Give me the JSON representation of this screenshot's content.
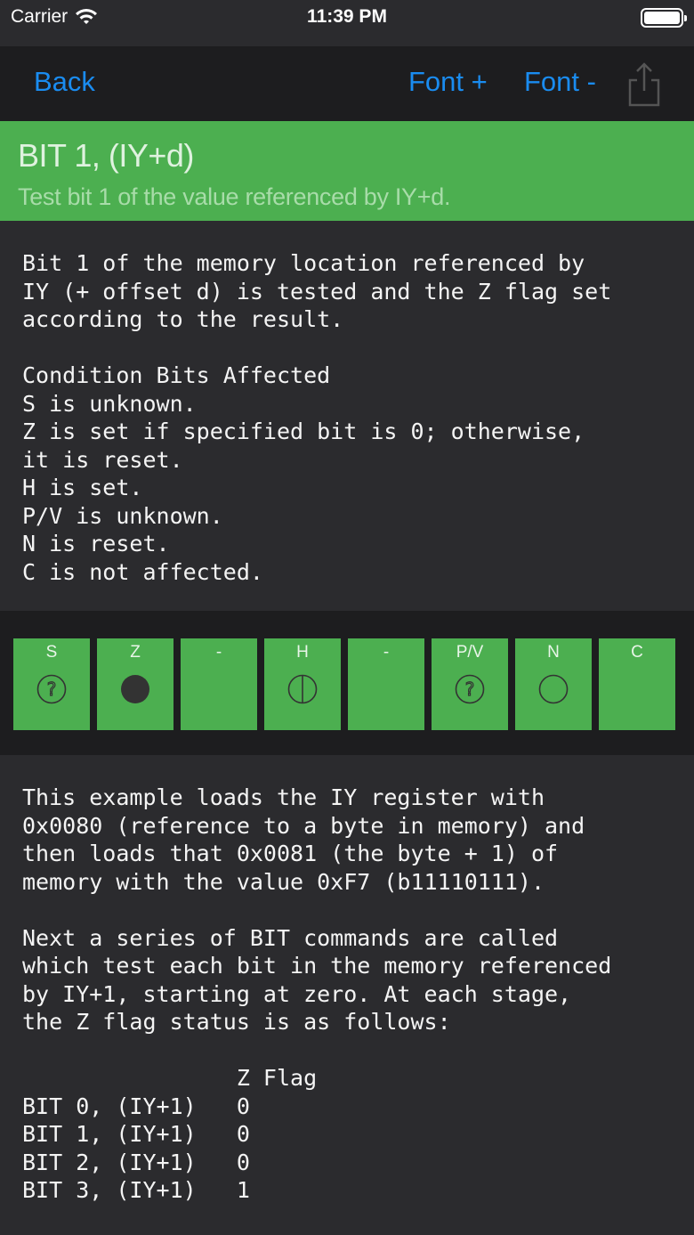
{
  "status_bar": {
    "carrier": "Carrier",
    "time": "11:39 PM"
  },
  "nav": {
    "back": "Back",
    "font_plus": "Font +",
    "font_minus": "Font -",
    "share_icon": "share-icon"
  },
  "header": {
    "title": "BIT 1, (IY+d)",
    "subtitle": "Test bit 1 of the value referenced by IY+d.",
    "color": "#4caf50"
  },
  "description": "Bit 1 of the memory location referenced by\nIY (+ offset d) is tested and the Z flag set\naccording to the result.\n\nCondition Bits Affected\nS is unknown.\nZ is set if specified bit is 0; otherwise,\nit is reset.\nH is set.\nP/V is unknown.\nN is reset.\nC is not affected.",
  "flags": [
    {
      "label": "S",
      "state": "unknown"
    },
    {
      "label": "Z",
      "state": "set-if"
    },
    {
      "label": "-",
      "state": "none"
    },
    {
      "label": "H",
      "state": "set"
    },
    {
      "label": "-",
      "state": "none"
    },
    {
      "label": "P/V",
      "state": "unknown"
    },
    {
      "label": "N",
      "state": "reset"
    },
    {
      "label": "C",
      "state": "none"
    }
  ],
  "example": "This example loads the IY register with\n0x0080 (reference to a byte in memory) and\nthen loads that 0x0081 (the byte + 1) of\nmemory with the value 0xF7 (b11110111).\n\nNext a series of BIT commands are called\nwhich test each bit in the memory referenced\nby IY+1, starting at zero. At each stage,\nthe Z flag status is as follows:\n\n                Z Flag\nBIT 0, (IY+1)   0\nBIT 1, (IY+1)   0\nBIT 2, (IY+1)   0\nBIT 3, (IY+1)   1"
}
